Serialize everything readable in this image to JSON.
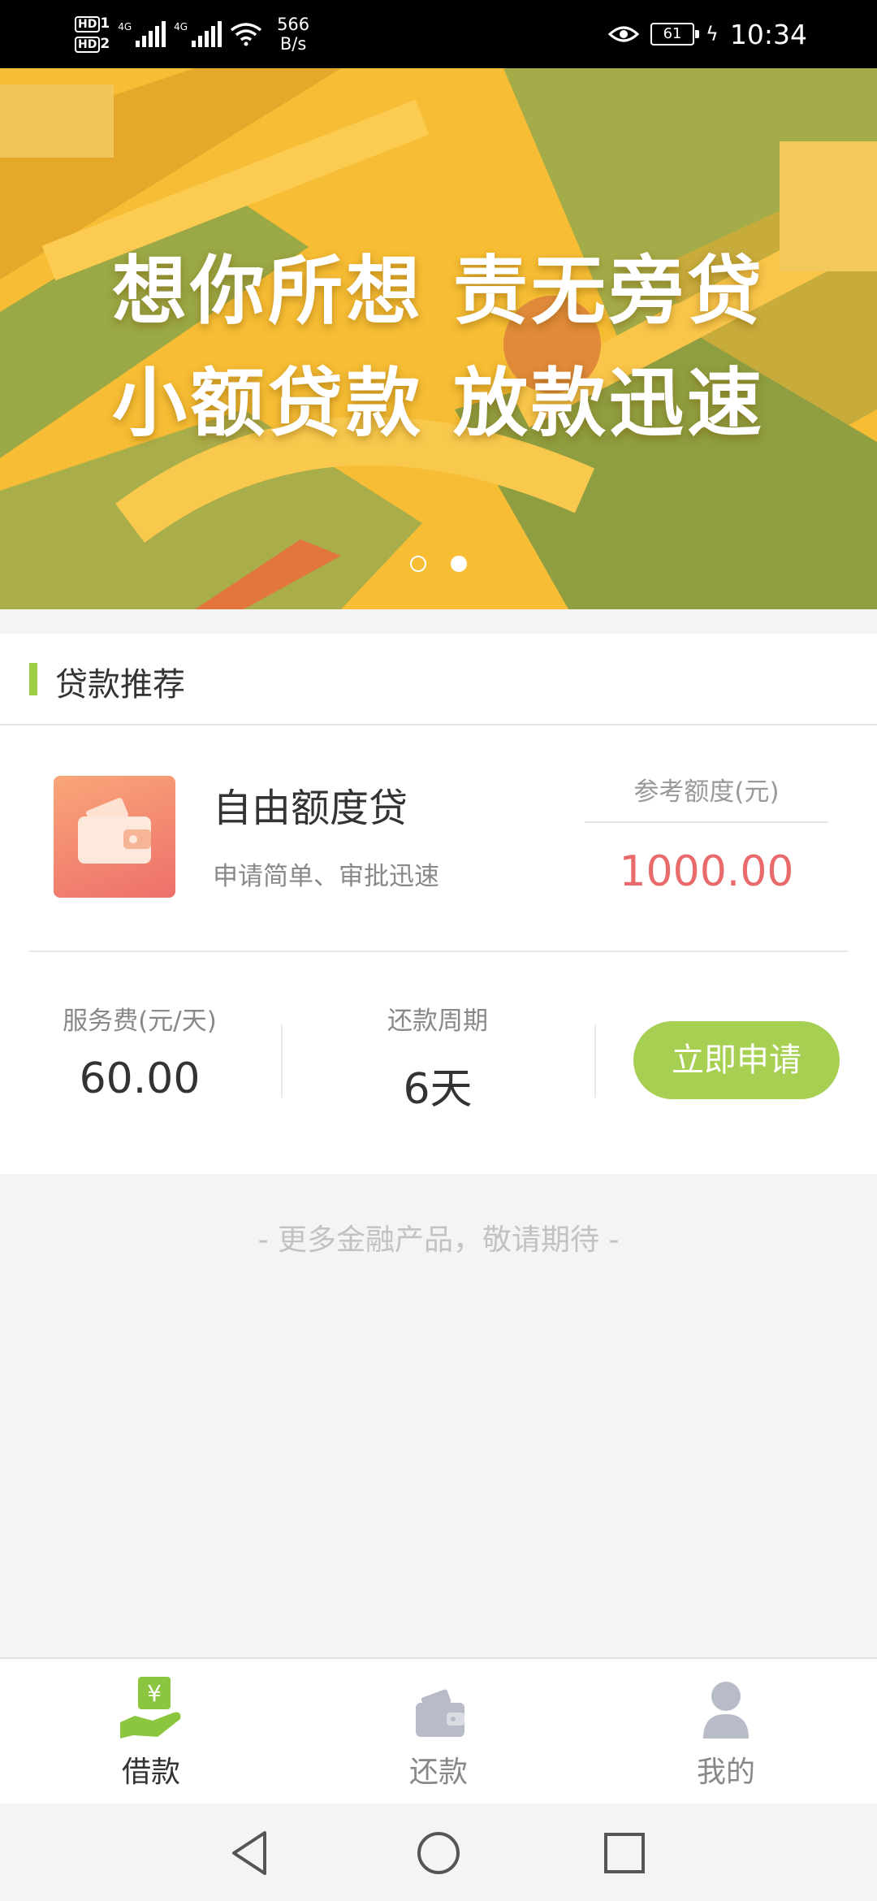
{
  "status_bar": {
    "hd1": "HD",
    "hd1_sub": "1",
    "hd2": "HD",
    "hd2_sub": "2",
    "net1": "4G",
    "net2": "4G",
    "speed_value": "566",
    "speed_unit": "B/s",
    "battery": "61",
    "time": "10:34"
  },
  "banner": {
    "line1": "想你所想 责无旁贷",
    "line2": "小额贷款 放款迅速",
    "active_slide": 2,
    "slide_count": 2
  },
  "section": {
    "title": "贷款推荐",
    "accent_color": "#9fcd45"
  },
  "product": {
    "name": "自由额度贷",
    "description": "申请简单、审批迅速",
    "quota_label": "参考额度(元)",
    "quota_value": "1000.00",
    "fee_label": "服务费(元/天)",
    "fee_value": "60.00",
    "cycle_label": "还款周期",
    "cycle_value": "6天",
    "apply_label": "立即申请",
    "icon": "wallet-icon",
    "quota_color": "#e96a6a",
    "button_color": "#a7cf52"
  },
  "more_text": "- 更多金融产品，敬请期待 -",
  "bottom_nav": {
    "items": [
      {
        "label": "借款",
        "icon": "yen-hand-icon",
        "active": true
      },
      {
        "label": "还款",
        "icon": "wallet-icon",
        "active": false
      },
      {
        "label": "我的",
        "icon": "user-icon",
        "active": false
      }
    ],
    "active_color": "#8cc63f",
    "inactive_color": "#b8bcc8"
  }
}
